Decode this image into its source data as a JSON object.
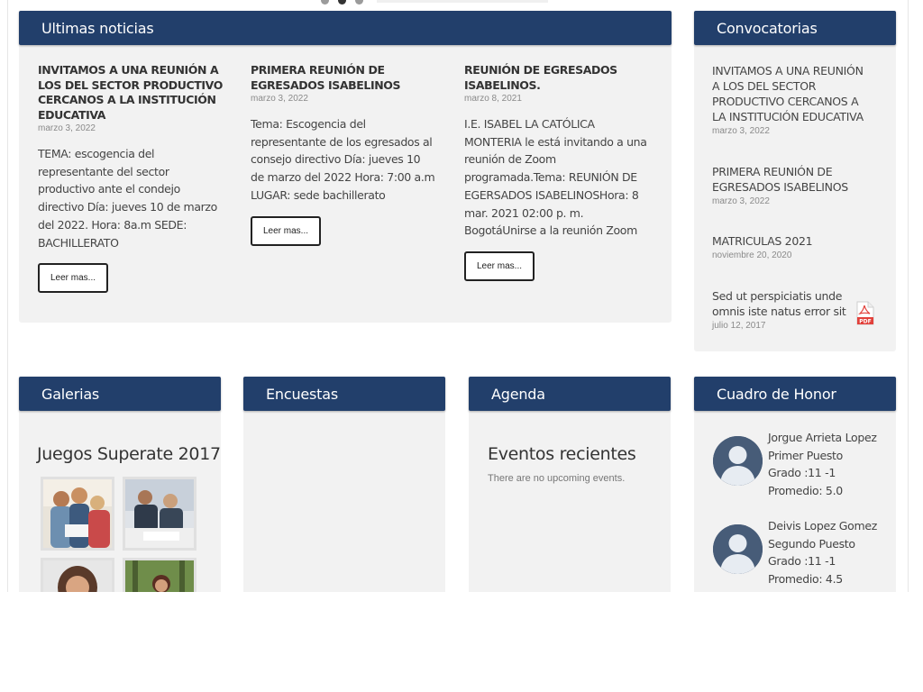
{
  "news": {
    "heading": "Ultimas noticias",
    "items": [
      {
        "title": "INVITAMOS A UNA REUNIÓN A LOS DEL SECTOR PRODUCTIVO CERCANOS A LA INSTITUCIÓN EDUCATIVA",
        "date": "marzo 3, 2022",
        "body": "TEMA: escogencia del representante del sector productivo ante el condejo directivo Día: jueves 10 de marzo del 2022. Hora: 8a.m SEDE: BACHILLERATO",
        "button": "Leer mas..."
      },
      {
        "title": "PRIMERA REUNIÓN DE EGRESADOS ISABELINOS",
        "date": "marzo 3, 2022",
        "body": "Tema: Escogencia del representante de los egresados al consejo directivo Día: jueves 10 de marzo del 2022 Hora: 7:00 a.m LUGAR: sede bachillerato",
        "button": "Leer mas..."
      },
      {
        "title": "REUNIÓN DE EGRESADOS ISABELINOS.",
        "date": "marzo 8, 2021",
        "body": "I.E. ISABEL LA CATÓLICA MONTERIA le está invitando a una reunión de Zoom programada.Tema: REUNIÓN DE EGERSADOS ISABELINOSHora: 8 mar. 2021 02:00 p. m. BogotáUnirse a la reunión Zoom",
        "button": "Leer mas..."
      }
    ]
  },
  "convocatorias": {
    "heading": "Convocatorias",
    "items": [
      {
        "title": "INVITAMOS A UNA REUNIÓN A LOS DEL SECTOR PRODUCTIVO CERCANOS A LA INSTITUCIÓN EDUCATIVA",
        "date": "marzo 3, 2022"
      },
      {
        "title": "PRIMERA REUNIÓN DE EGRESADOS ISABELINOS",
        "date": "marzo 3, 2022"
      },
      {
        "title": "MATRICULAS 2021",
        "date": "noviembre 20, 2020"
      },
      {
        "title": "Sed ut perspiciatis unde omnis iste natus error sit",
        "date": "julio 12, 2017",
        "icon": "pdf-icon"
      }
    ]
  },
  "galerias": {
    "heading": "Galerias",
    "album_title": "Juegos Superate 2017"
  },
  "encuestas": {
    "heading": "Encuestas"
  },
  "agenda": {
    "heading": "Agenda",
    "title": "Eventos recientes",
    "empty": "There are no upcoming events."
  },
  "honor": {
    "heading": "Cuadro de Honor",
    "students": [
      {
        "name": "Jorgue Arrieta Lopez",
        "place": "Primer Puesto",
        "grade": "Grado :11 -1",
        "average": "Promedio: 5.0"
      },
      {
        "name": "Deivis Lopez Gomez",
        "place": "Segundo Puesto",
        "grade": "Grado :11 -1",
        "average": "Promedio: 4.5"
      }
    ]
  },
  "colors": {
    "header_blue": "#223f6b",
    "panel_gray": "#f2f2f2",
    "pdf_red": "#e2413b"
  }
}
